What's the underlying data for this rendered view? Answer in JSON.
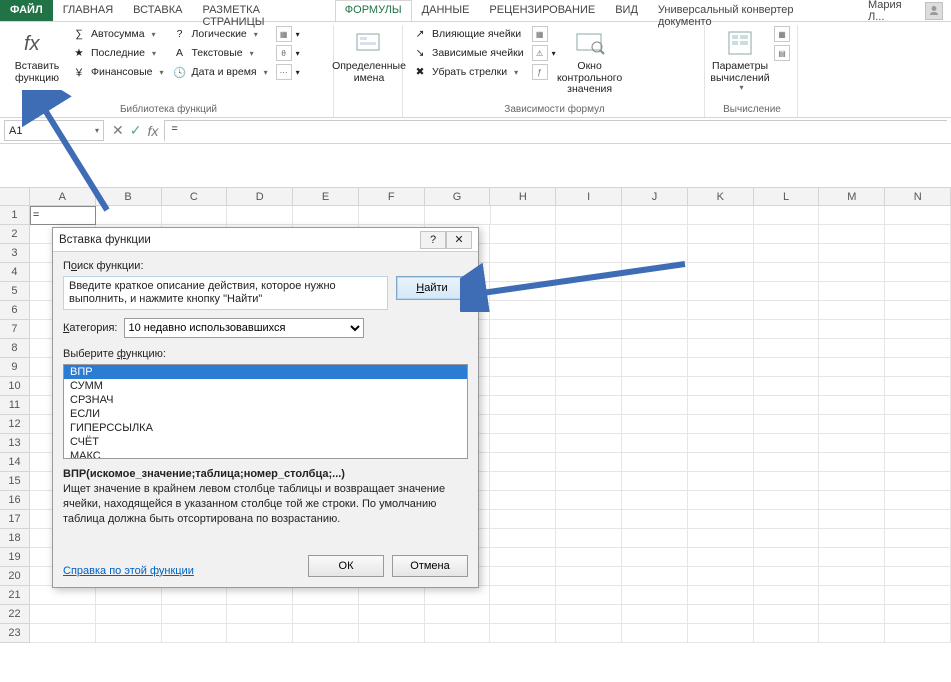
{
  "tabs": {
    "file": "ФАЙЛ",
    "items": [
      "ГЛАВНАЯ",
      "ВСТАВКА",
      "РАЗМЕТКА СТРАНИЦЫ",
      "ФОРМУЛЫ",
      "ДАННЫЕ",
      "РЕЦЕНЗИРОВАНИЕ",
      "ВИД",
      "Универсальный конвертер документо"
    ],
    "active_index": 3,
    "user": "Мария Л..."
  },
  "ribbon": {
    "insert_fn_top": "Вставить",
    "insert_fn_bottom": "функцию",
    "library": {
      "label": "Библиотека функций",
      "col1": [
        "Автосумма",
        "Последние",
        "Финансовые"
      ],
      "col2": [
        "Логические",
        "Текстовые",
        "Дата и время"
      ]
    },
    "defined_names": {
      "big_top": "Определенные",
      "big_bottom": "имена"
    },
    "audit": {
      "label": "Зависимости формул",
      "col1": [
        "Влияющие ячейки",
        "Зависимые ячейки",
        "Убрать стрелки"
      ],
      "watch_top": "Окно контрольного",
      "watch_bottom": "значения"
    },
    "calc": {
      "big_top": "Параметры",
      "big_bottom": "вычислений",
      "label": "Вычисление"
    }
  },
  "fbar": {
    "namebox": "A1",
    "formula": "="
  },
  "grid": {
    "cols": [
      "A",
      "B",
      "C",
      "D",
      "E",
      "F",
      "G",
      "H",
      "I",
      "J",
      "K",
      "L",
      "M",
      "N"
    ],
    "rows": 23,
    "active_cell_value": "="
  },
  "dialog": {
    "title": "Вставка функции",
    "search_label_pre": "П",
    "search_label_u": "о",
    "search_label_post": "иск функции:",
    "search_text": "Введите краткое описание действия, которое нужно выполнить, и нажмите кнопку \"Найти\"",
    "find_u": "Н",
    "find_post": "айти",
    "cat_label_pre": "",
    "cat_label_u": "К",
    "cat_label_post": "атегория:",
    "cat_value": "10 недавно использовавшихся",
    "choose_label_pre": "Выберите ",
    "choose_label_u": "ф",
    "choose_label_post": "ункцию:",
    "functions": [
      "ВПР",
      "СУММ",
      "СРЗНАЧ",
      "ЕСЛИ",
      "ГИПЕРССЫЛКА",
      "СЧЁТ",
      "МАКС"
    ],
    "selected_index": 0,
    "sig": "ВПР(искомое_значение;таблица;номер_столбца;...)",
    "desc": "Ищет значение в крайнем левом столбце таблицы и возвращает значение ячейки, находящейся в указанном столбце той же строки. По умолчанию таблица должна быть отсортирована по возрастанию.",
    "help": "Справка по этой функции",
    "ok": "ОК",
    "cancel": "Отмена"
  }
}
